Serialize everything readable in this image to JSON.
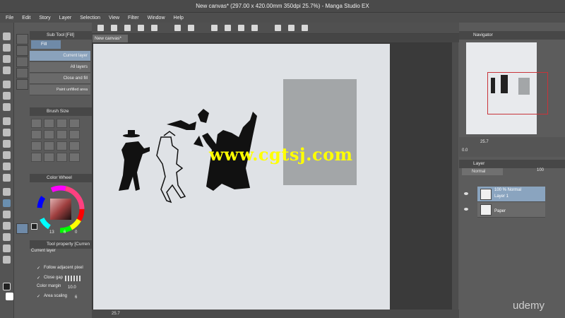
{
  "window": {
    "title": "New canvas* (297.00 x 420.00mm 350dpi 25.7%) - Manga Studio EX"
  },
  "menu": [
    "File",
    "Edit",
    "Story",
    "Layer",
    "Selection",
    "View",
    "Filter",
    "Window",
    "Help"
  ],
  "subtool": {
    "header": "Sub Tool [Fill]",
    "tab": "Fill",
    "items": [
      "Current layer",
      "All layers",
      "Close and fill",
      "Paint unfilled area"
    ],
    "selected_index": 0
  },
  "brush_size": {
    "header": "Brush Size"
  },
  "color_wheel": {
    "header": "Color Wheel",
    "values": [
      "13",
      "6",
      "0"
    ]
  },
  "tool_property": {
    "header": "Tool property [Curren",
    "current_layer": "Current layer",
    "follow_adjacent": "Follow adjacent pixel",
    "close_gap": "Close gap",
    "color_margin": "Color margin",
    "color_margin_value": "10.0",
    "area_scaling": "Area scaling",
    "area_scaling_value": "6"
  },
  "canvas": {
    "tab": "New canvas*",
    "zoom": "25.7"
  },
  "navigator": {
    "header": "Navigator",
    "zoom": "25.7",
    "rotation": "0.0"
  },
  "layers": {
    "header": "Layer",
    "blend_mode": "Normal",
    "opacity": "100",
    "rows": [
      {
        "line1": "100 %  Normal",
        "line2": "Layer 1",
        "selected": true
      },
      {
        "line1": "Paper",
        "line2": "",
        "selected": false
      }
    ]
  },
  "watermark": "www.cgtsj.com",
  "brand": "udemy",
  "colors": {
    "accent": "#8aa4bf",
    "paper": "#dfe2e6",
    "gray_rect": "#a3a6a8",
    "nav_frame": "#c8343a",
    "watermark": "#ffff00"
  }
}
